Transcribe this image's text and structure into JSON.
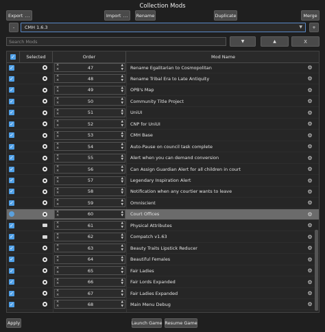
{
  "window": {
    "title": "Collection Mods"
  },
  "toolbar": {
    "export_label": "Export",
    "import_label": "Import",
    "rename_label": "Rename",
    "duplicate_label": "Duplicate",
    "merge_label": "Merge",
    "dots": "...",
    "minus_label": "-",
    "plus_label": "+"
  },
  "collection": {
    "selected": "CMH 1.6.3"
  },
  "search": {
    "placeholder": "Search Mods"
  },
  "nav": {
    "down_label": "▼",
    "up_label": "▲",
    "clear_label": "X"
  },
  "table": {
    "headers": {
      "selected": "Selected",
      "order": "Order",
      "mod_name": "Mod Name"
    },
    "rows": [
      {
        "order": "47",
        "name": "Rename Egalitarian to Cosmopolitan",
        "source": "steam",
        "selected": false
      },
      {
        "order": "48",
        "name": "Rename Tribal Era to Late Antiquity",
        "source": "steam",
        "selected": false
      },
      {
        "order": "49",
        "name": "OPB's Map",
        "source": "steam",
        "selected": false
      },
      {
        "order": "50",
        "name": "Community Title Project",
        "source": "steam",
        "selected": false
      },
      {
        "order": "51",
        "name": "UniUI",
        "source": "steam",
        "selected": false
      },
      {
        "order": "52",
        "name": "CNP for UniUI",
        "source": "steam",
        "selected": false
      },
      {
        "order": "53",
        "name": "CMH Base",
        "source": "steam",
        "selected": false
      },
      {
        "order": "54",
        "name": "Auto-Pause on council task complete",
        "source": "steam",
        "selected": false
      },
      {
        "order": "55",
        "name": "Alert when you can demand conversion",
        "source": "steam",
        "selected": false
      },
      {
        "order": "56",
        "name": "Can Assign Guardian Alert for all children in court",
        "source": "steam",
        "selected": false
      },
      {
        "order": "57",
        "name": "Legendary Inspiration Alert",
        "source": "steam",
        "selected": false
      },
      {
        "order": "58",
        "name": "Notification when any courtier wants to leave",
        "source": "steam",
        "selected": false
      },
      {
        "order": "59",
        "name": "Omniscient",
        "source": "steam",
        "selected": false
      },
      {
        "order": "60",
        "name": "Court Offices",
        "source": "steam",
        "selected": true
      },
      {
        "order": "61",
        "name": "Physical Attributes",
        "source": "local",
        "selected": false
      },
      {
        "order": "62",
        "name": "Compatch v1.63",
        "source": "local",
        "selected": false
      },
      {
        "order": "63",
        "name": "Beauty Traits Lipstick Reducer",
        "source": "steam",
        "selected": false
      },
      {
        "order": "64",
        "name": "Beautiful Females",
        "source": "steam",
        "selected": false
      },
      {
        "order": "65",
        "name": "Fair Ladies",
        "source": "steam",
        "selected": false
      },
      {
        "order": "66",
        "name": "Fair Lords Expanded",
        "source": "steam",
        "selected": false
      },
      {
        "order": "67",
        "name": "Fair Ladies Expanded",
        "source": "steam",
        "selected": false
      },
      {
        "order": "68",
        "name": "Main Menu Debug",
        "source": "steam",
        "selected": false
      }
    ]
  },
  "footer": {
    "apply_label": "Apply",
    "launch_label": "Launch Game",
    "resume_label": "Resume Game"
  },
  "colors": {
    "accent": "#4fa0e8",
    "selected_row": "#6b6b6b",
    "background": "#1f1f1f"
  }
}
